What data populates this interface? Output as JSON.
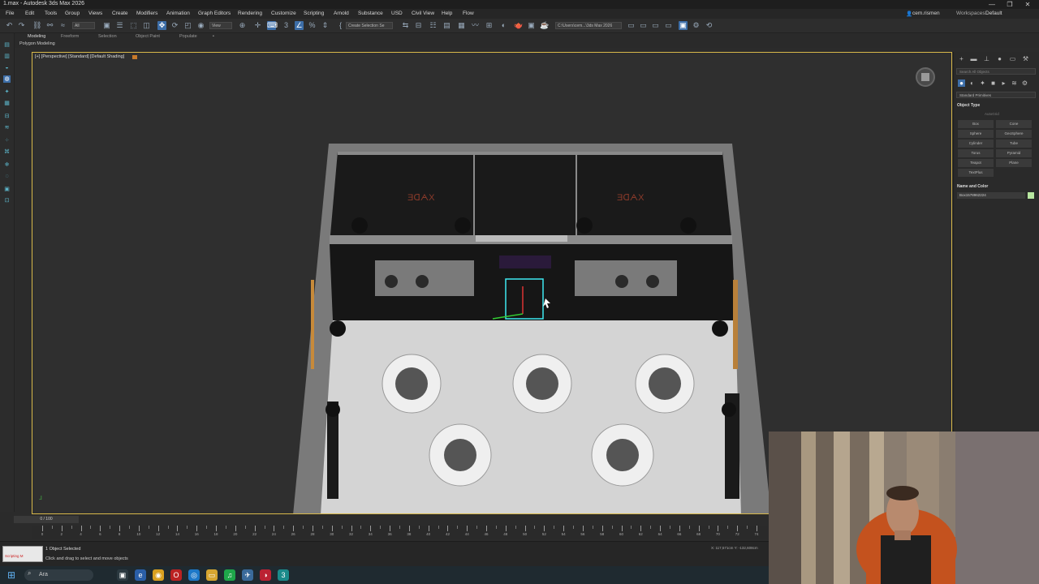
{
  "window": {
    "title": "1.max - Autodesk 3ds Max 2026",
    "controls": [
      "—",
      "❐",
      "✕"
    ]
  },
  "menu": [
    "File",
    "Edit",
    "Tools",
    "Group",
    "Views",
    "Create",
    "Modifiers",
    "Animation",
    "Graph Editors",
    "Rendering",
    "Customize",
    "Scripting",
    "Arnold",
    "Substance",
    "USD",
    "Civil View",
    "Help",
    "Flow"
  ],
  "account": {
    "user": "cem.rismen",
    "workspaces_label": "Workspaces:",
    "workspace": "Default"
  },
  "toolbar": {
    "selection_filter": "All",
    "view_dropdown": "View",
    "named_selection": "Create Selection Se",
    "path": "C:\\Users\\cem...\\3ds Max 2026"
  },
  "ribbon": {
    "tabs": [
      "Modeling",
      "Freeform",
      "Selection",
      "Object Paint",
      "Populate"
    ],
    "active": "Modeling",
    "sublabel": "Polygon Modeling"
  },
  "viewport": {
    "label": "[+] [Perspective] [Standard] [Default Shading]"
  },
  "command_panel": {
    "search_placeholder": "Search All Objects",
    "category": "Standard Primitives",
    "object_type_title": "Object Type",
    "autogrid": "AutoGrid",
    "buttons": [
      "Box",
      "Cone",
      "Sphere",
      "GeoSphere",
      "Cylinder",
      "Tube",
      "Torus",
      "Pyramid",
      "Teapot",
      "Plane",
      "TextPlus"
    ],
    "name_color_title": "Name and Color",
    "object_name": "Box1578962224",
    "object_color": "#b8e6a0"
  },
  "timeline": {
    "slider": "0 / 100",
    "ticks": [
      0,
      2,
      4,
      6,
      8,
      10,
      12,
      14,
      16,
      18,
      20,
      22,
      24,
      26,
      28,
      30,
      32,
      34,
      36,
      38,
      40,
      42,
      44,
      46,
      48,
      50,
      52,
      54,
      56,
      58,
      60,
      62,
      64,
      66,
      68,
      70,
      72,
      74
    ]
  },
  "status": {
    "maxscript_label": "Scripting M",
    "selected": "1 Object Selected",
    "hint": "Click and drag to select and move objects",
    "coords": "X: 117,571cm  Y: -132,608cm"
  },
  "taskbar": {
    "search": "Ara"
  }
}
